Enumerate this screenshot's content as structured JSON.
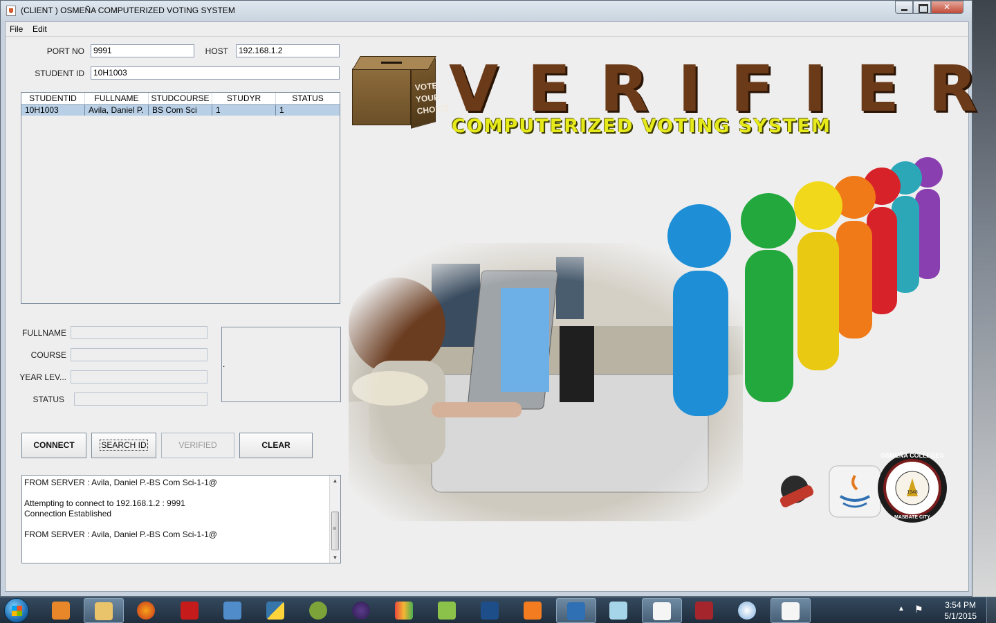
{
  "window": {
    "title": "(CLIENT ) OSMEÑA COMPUTERIZED VOTING SYSTEM"
  },
  "menu": {
    "file": "File",
    "edit": "Edit"
  },
  "connection": {
    "port_label": "PORT NO",
    "port_value": "9991",
    "host_label": "HOST",
    "host_value": "192.168.1.2",
    "student_id_label": "STUDENT ID",
    "student_id_value": "10H1003"
  },
  "table": {
    "columns": [
      "STUDENTID",
      "FULLNAME",
      "STUDCOURSE",
      "STUDYR",
      "STATUS"
    ],
    "rows": [
      [
        "10H1003",
        "Avila, Daniel P.",
        "BS Com Sci",
        "1",
        "1"
      ]
    ]
  },
  "details": {
    "fullname_label": "FULLNAME",
    "fullname_value": "",
    "course_label": "COURSE",
    "course_value": "",
    "year_label": "YEAR LEV...",
    "year_value": "",
    "status_label": "STATUS",
    "status_value": "",
    "photo_text": "."
  },
  "buttons": {
    "connect": "CONNECT",
    "search": "SEARCH ID",
    "verified": "VERIFIED",
    "clear": "CLEAR"
  },
  "log": {
    "lines": [
      "FROM SERVER : Avila, Daniel P.-BS Com Sci-1-1@",
      "",
      "Attempting to connect to 192.168.1.2 : 9991",
      "Connection Established",
      "",
      "FROM SERVER : Avila, Daniel P.-BS Com Sci-1-1@"
    ]
  },
  "banner": {
    "ballot_box_text": "VOTE YOUR CHOICE",
    "title": "VERIFIER",
    "subtitle": "COMPUTERIZED VOTING SYSTEM"
  },
  "logos": {
    "college_seal": "OSMEÑA COLLEGES",
    "seal_city": "MASBATE CITY",
    "seal_year": "1948"
  },
  "taskbar": {
    "time": "3:54 PM",
    "date": "5/1/2015"
  },
  "colors": {
    "banner_brown": "#6b3a18",
    "banner_yellow": "#e6ea1a",
    "selection": "#b8cfe5"
  }
}
